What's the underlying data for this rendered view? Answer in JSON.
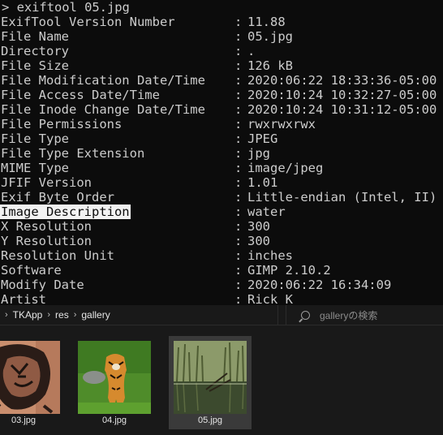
{
  "terminal": {
    "prompt": "> exiftool 05.jpg",
    "rows": [
      {
        "key": "ExifTool Version Number",
        "value": "11.88"
      },
      {
        "key": "File Name",
        "value": "05.jpg"
      },
      {
        "key": "Directory",
        "value": "."
      },
      {
        "key": "File Size",
        "value": "126 kB"
      },
      {
        "key": "File Modification Date/Time",
        "value": "2020:06:22 18:33:36-05:00"
      },
      {
        "key": "File Access Date/Time",
        "value": "2020:10:24 10:32:27-05:00"
      },
      {
        "key": "File Inode Change Date/Time",
        "value": "2020:10:24 10:31:12-05:00"
      },
      {
        "key": "File Permissions",
        "value": "rwxrwxrwx"
      },
      {
        "key": "File Type",
        "value": "JPEG"
      },
      {
        "key": "File Type Extension",
        "value": "jpg"
      },
      {
        "key": "MIME Type",
        "value": "image/jpeg"
      },
      {
        "key": "JFIF Version",
        "value": "1.01"
      },
      {
        "key": "Exif Byte Order",
        "value": "Little-endian (Intel, II)"
      },
      {
        "key": "Image Description",
        "value": "water",
        "selected": true
      },
      {
        "key": "X Resolution",
        "value": "300"
      },
      {
        "key": "Y Resolution",
        "value": "300"
      },
      {
        "key": "Resolution Unit",
        "value": "inches"
      },
      {
        "key": "Software",
        "value": "GIMP 2.10.2"
      },
      {
        "key": "Modify Date",
        "value": "2020:06:22 16:34:09"
      },
      {
        "key": "Artist",
        "value": "Rick K"
      }
    ]
  },
  "explorer": {
    "breadcrumb": [
      "TKApp",
      "res",
      "gallery"
    ],
    "search_placeholder": "galleryの検索",
    "files": [
      {
        "name": "03.jpg",
        "thumb": "tattoo-lion"
      },
      {
        "name": "04.jpg",
        "thumb": "tiger-grass"
      },
      {
        "name": "05.jpg",
        "thumb": "pond-reeds",
        "selected": true
      }
    ]
  }
}
